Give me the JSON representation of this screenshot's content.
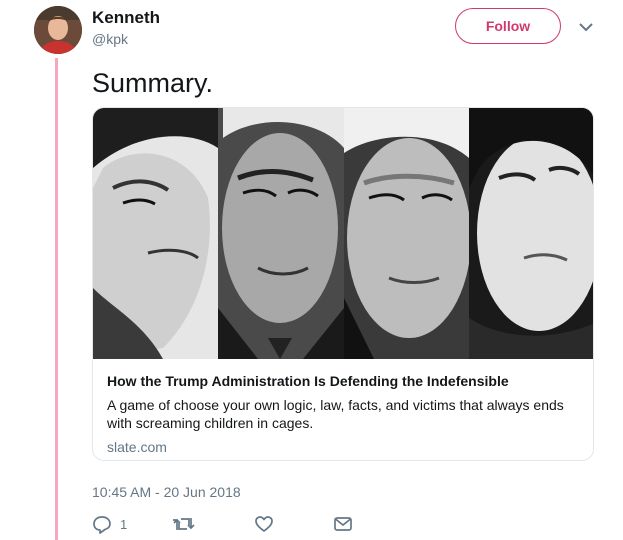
{
  "author": {
    "display_name": "Kenneth",
    "handle": "@kpk"
  },
  "header": {
    "follow_label": "Follow"
  },
  "tweet": {
    "text": "Summary.",
    "timestamp": "10:45 AM - 20 Jun 2018"
  },
  "card": {
    "title": "How the Trump Administration Is Defending the Indefensible",
    "description": "A game of choose your own logic, law, facts, and victims that always ends with screaming children in cages.",
    "domain": "slate.com"
  },
  "actions": {
    "reply_count": "1",
    "icons": [
      "reply-icon",
      "retweet-icon",
      "like-icon",
      "dm-icon"
    ]
  },
  "colors": {
    "accent": "#d0396f",
    "thread_line": "#f4a7bd",
    "secondary_text": "#657786",
    "border": "#e1e8ed"
  }
}
